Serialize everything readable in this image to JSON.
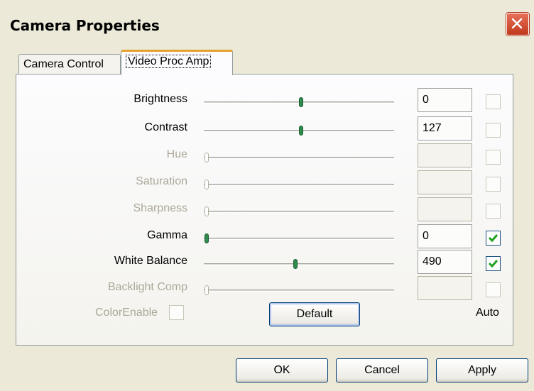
{
  "window": {
    "title": "Camera Properties"
  },
  "tabs": [
    {
      "label": "Camera Control"
    },
    {
      "label": "Video Proc Amp"
    }
  ],
  "properties": [
    {
      "label": "Brightness",
      "value": "0",
      "slider_fraction": 0.51,
      "enabled": true,
      "auto": false
    },
    {
      "label": "Contrast",
      "value": "127",
      "slider_fraction": 0.51,
      "enabled": true,
      "auto": false
    },
    {
      "label": "Hue",
      "value": "",
      "slider_fraction": 0.0,
      "enabled": false,
      "auto": false
    },
    {
      "label": "Saturation",
      "value": "",
      "slider_fraction": 0.0,
      "enabled": false,
      "auto": false
    },
    {
      "label": "Sharpness",
      "value": "",
      "slider_fraction": 0.0,
      "enabled": false,
      "auto": false
    },
    {
      "label": "Gamma",
      "value": "0",
      "slider_fraction": 0.0,
      "enabled": true,
      "auto": true
    },
    {
      "label": "White Balance",
      "value": "490",
      "slider_fraction": 0.48,
      "enabled": true,
      "auto": true
    },
    {
      "label": "Backlight Comp",
      "value": "",
      "slider_fraction": 0.0,
      "enabled": false,
      "auto": false
    }
  ],
  "color_enable": {
    "label": "ColorEnable",
    "checked": false
  },
  "default_button": "Default",
  "auto_label": "Auto",
  "buttons": {
    "ok": "OK",
    "cancel": "Cancel",
    "apply": "Apply"
  },
  "colors": {
    "titlebar_bg": "#ece9d8",
    "close_button": "#d9512c",
    "slider_thumb": "#2f8a4e",
    "tab_highlight": "#e8a030"
  }
}
